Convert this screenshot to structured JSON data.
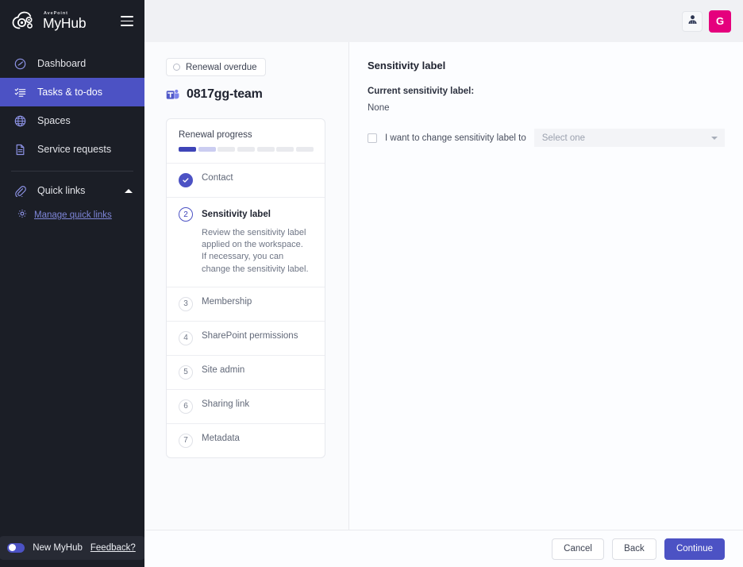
{
  "sidebar": {
    "brand": {
      "superscript": "AvePoint",
      "name": "MyHub",
      "logo_icon": "cloud-gear-logo",
      "menu_icon": "hamburger-icon"
    },
    "items": [
      {
        "label": "Dashboard",
        "icon": "dashboard-gauge-icon",
        "active": false
      },
      {
        "label": "Tasks & to-dos",
        "icon": "tasks-list-icon",
        "active": true
      },
      {
        "label": "Spaces",
        "icon": "globe-icon",
        "active": false
      },
      {
        "label": "Service requests",
        "icon": "document-icon",
        "active": false
      }
    ],
    "quick_links": {
      "label": "Quick links",
      "icon": "paperclip-icon",
      "collapse_icon": "chevron-up-icon",
      "manage_label": "Manage quick links",
      "manage_icon": "gear-icon"
    },
    "footer": {
      "toggle_label": "New MyHub",
      "toggle_on": true,
      "feedback_label": "Feedback?"
    },
    "colors": {
      "background": "#1b1e26",
      "active": "#4c52c4",
      "link": "#7e86d8"
    }
  },
  "topbar": {
    "user_icon": "person-icon",
    "avatar_initial": "G",
    "avatar_color": "#e5007d"
  },
  "wizard": {
    "status_chip": {
      "label": "Renewal overdue",
      "icon": "status-circle-icon"
    },
    "workspace_title": "0817gg-team",
    "workspace_icon": "microsoft-teams-icon",
    "progress": {
      "title": "Renewal progress",
      "total_segments": 7,
      "completed": 1,
      "current": 2
    },
    "steps": [
      {
        "number": "1",
        "label": "Contact",
        "state": "done",
        "description": ""
      },
      {
        "number": "2",
        "label": "Sensitivity label",
        "state": "current",
        "description": "Review the sensitivity label applied on the workspace. If necessary, you can change the sensitivity label."
      },
      {
        "number": "3",
        "label": "Membership",
        "state": "todo",
        "description": ""
      },
      {
        "number": "4",
        "label": "SharePoint permissions",
        "state": "todo",
        "description": ""
      },
      {
        "number": "5",
        "label": "Site admin",
        "state": "todo",
        "description": ""
      },
      {
        "number": "6",
        "label": "Sharing link",
        "state": "todo",
        "description": ""
      },
      {
        "number": "7",
        "label": "Metadata",
        "state": "todo",
        "description": ""
      }
    ]
  },
  "detail": {
    "title": "Sensitivity label",
    "current_label_title": "Current sensitivity label:",
    "current_label_value": "None",
    "change_checkbox_label": "I want to change sensitivity label to",
    "change_checkbox_checked": false,
    "select_placeholder": "Select one",
    "select_icon": "chevron-down-icon"
  },
  "footer": {
    "cancel_label": "Cancel",
    "back_label": "Back",
    "continue_label": "Continue",
    "continue_color": "#4c52c4"
  }
}
